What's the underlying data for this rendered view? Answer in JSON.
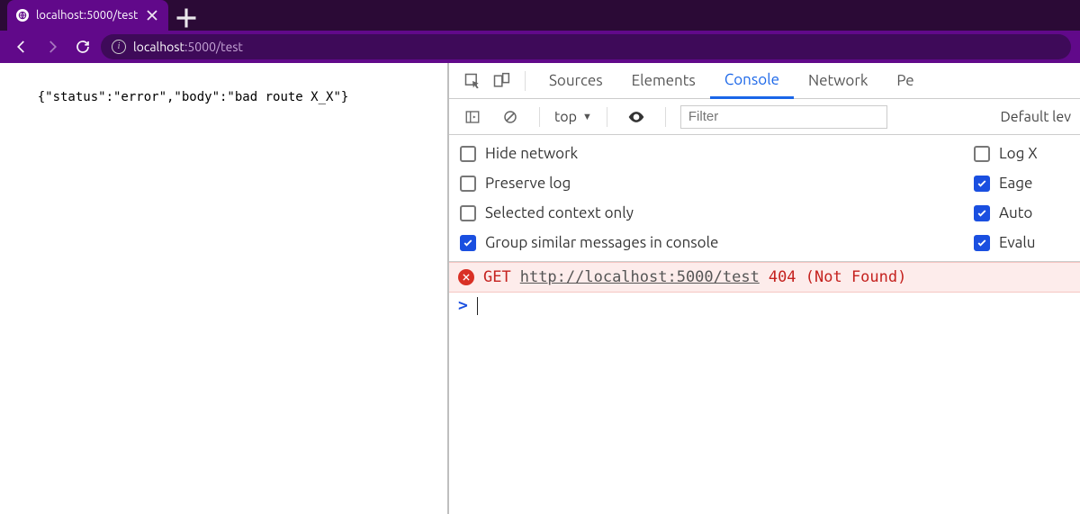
{
  "browser": {
    "tab": {
      "title": "localhost:5000/test"
    },
    "url": {
      "host": "localhost",
      "rest": ":5000/test"
    }
  },
  "page": {
    "body_text": "{\"status\":\"error\",\"body\":\"bad route X_X\"}"
  },
  "devtools": {
    "tabs": {
      "sources": "Sources",
      "elements": "Elements",
      "console": "Console",
      "network": "Network",
      "performance_trunc": "Pe"
    },
    "console_toolbar": {
      "context": "top",
      "filter_placeholder": "Filter",
      "levels_trunc": "Default lev"
    },
    "settings": {
      "left": {
        "hide_network": "Hide network",
        "preserve_log": "Preserve log",
        "selected_context_only": "Selected context only",
        "group_similar": "Group similar messages in console"
      },
      "right": {
        "log_x_trunc": "Log X",
        "eager_trunc": "Eage",
        "auto_trunc": "Auto",
        "evalu_trunc": "Evalu"
      }
    },
    "message": {
      "method": "GET",
      "url": "http://localhost:5000/test",
      "status": "404 (Not Found)"
    },
    "prompt": ">"
  }
}
